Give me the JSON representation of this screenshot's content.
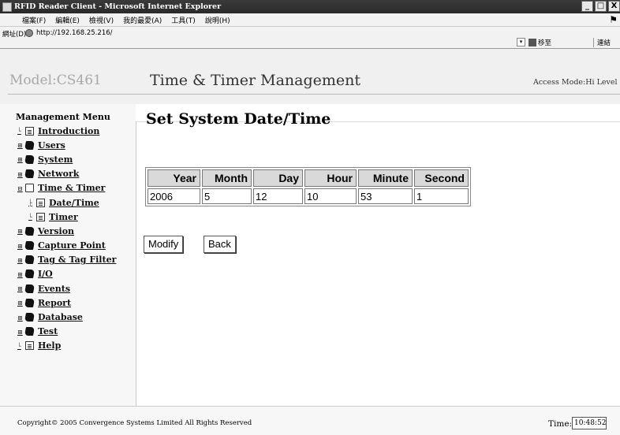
{
  "window": {
    "title": "RFID Reader Client - Microsoft Internet Explorer",
    "buttons": [
      "_",
      "□",
      "X"
    ]
  },
  "menubar": {
    "items": [
      "檔案(F)",
      "編輯(E)",
      "檢視(V)",
      "我的最愛(A)",
      "工具(T)",
      "說明(H)"
    ]
  },
  "addressbar": {
    "label": "網址(D)",
    "url": "http://192.168.25.216/",
    "go_label": "移至",
    "links_label": "連結"
  },
  "header": {
    "model": "Model:CS461",
    "page_title": "Time & Timer Management",
    "access_mode": "Access Mode:Hi Level"
  },
  "sidebar": {
    "title": "Management Menu",
    "items": [
      {
        "label": "Introduction",
        "icon": "page-icon"
      },
      {
        "label": "Users",
        "icon": "book-icon"
      },
      {
        "label": "System",
        "icon": "book-icon"
      },
      {
        "label": "Network",
        "icon": "book-icon"
      },
      {
        "label": "Time & Timer",
        "icon": "open-book-icon"
      },
      {
        "label": "Date/Time",
        "icon": "page-icon"
      },
      {
        "label": "Timer",
        "icon": "page-icon"
      },
      {
        "label": "Version",
        "icon": "book-icon"
      },
      {
        "label": "Capture Point",
        "icon": "book-icon"
      },
      {
        "label": "Tag & Tag Filter",
        "icon": "book-icon"
      },
      {
        "label": "I/O",
        "icon": "book-icon"
      },
      {
        "label": "Events",
        "icon": "book-icon"
      },
      {
        "label": "Report",
        "icon": "book-icon"
      },
      {
        "label": "Database",
        "icon": "book-icon"
      },
      {
        "label": "Test",
        "icon": "book-icon"
      },
      {
        "label": "Help",
        "icon": "page-icon"
      }
    ]
  },
  "main": {
    "heading": "Set System Date/Time",
    "table": {
      "headers": [
        "Year",
        "Month",
        "Day",
        "Hour",
        "Minute",
        "Second"
      ],
      "values": [
        "2006",
        "5",
        "12",
        "10",
        "53",
        "1"
      ]
    },
    "modify_label": "Modify",
    "back_label": "Back"
  },
  "footer": {
    "copyright": "Copyright© 2005 Convergence Systems Limited  All Rights Reserved",
    "time_label": "Time:",
    "time_value": "10:48:52"
  }
}
